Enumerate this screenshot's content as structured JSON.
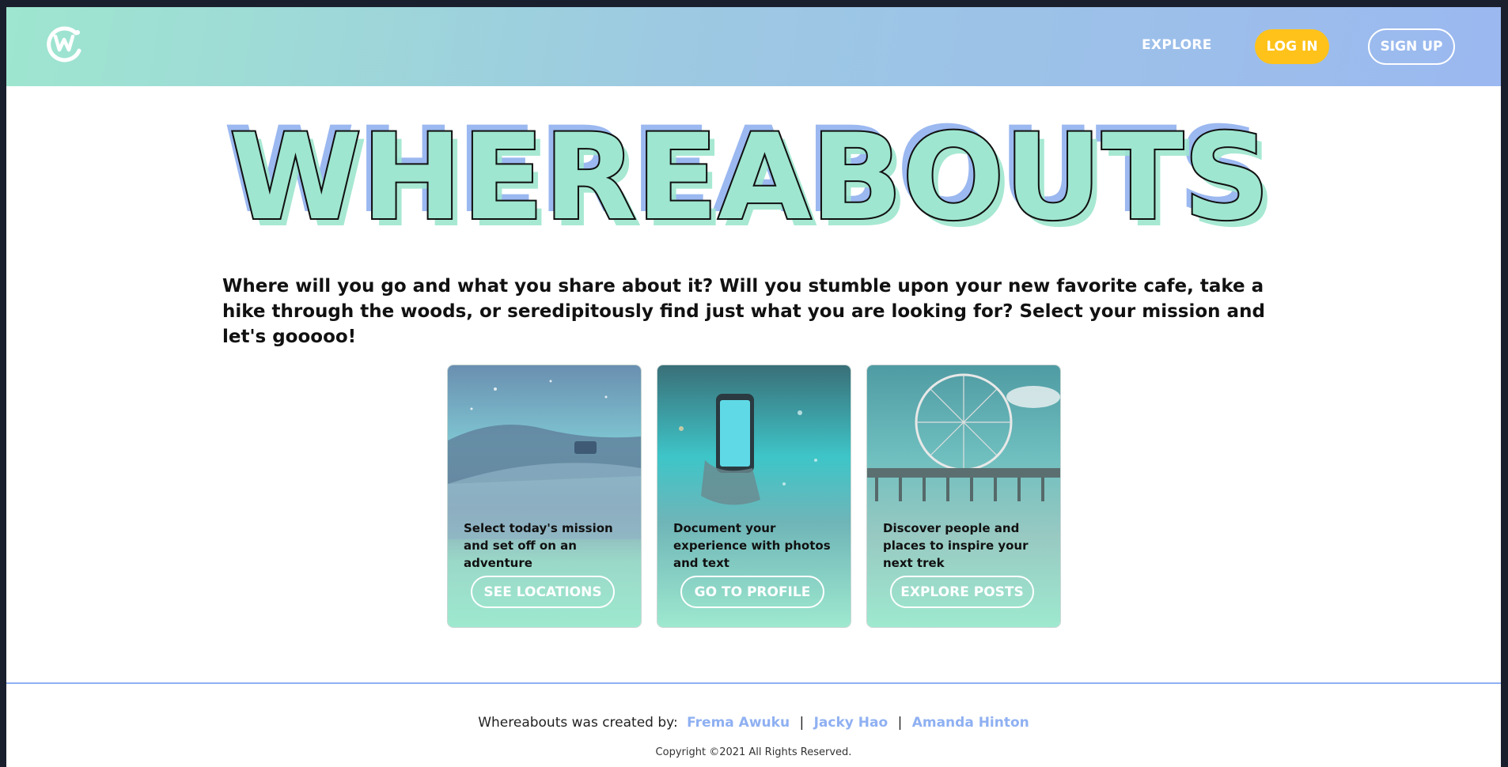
{
  "nav": {
    "logo_icon": "whereabouts-w-logo-icon",
    "explore_label": "EXPLORE",
    "login_label": "LOG IN",
    "signup_label": "SIGN UP"
  },
  "hero": {
    "title": "WHEREABOUTS",
    "intro": "Where will you go and what you share about it? Will you stumble upon your new favorite cafe, take a hike through the woods, or seredipitously find just what you are looking for? Select your mission and let's gooooo!"
  },
  "cards": [
    {
      "text": "Select today's mission and set off on an adventure",
      "button": "SEE LOCATIONS",
      "image": "night-sky-car-road-photo"
    },
    {
      "text": "Document your experience with photos and text",
      "button": "GO TO PROFILE",
      "image": "phone-fireworks-photo"
    },
    {
      "text": "Discover people and places to inspire your next trek",
      "button": "EXPLORE POSTS",
      "image": "ferris-wheel-pier-photo"
    }
  ],
  "footer": {
    "credits_prefix": "Whereabouts was created by:",
    "authors": [
      "Frema Awuku",
      "Jacky Hao",
      "Amanda Hinton"
    ],
    "separator": "|",
    "copyright": "Copyright ©2021 All Rights Reserved."
  },
  "colors": {
    "mint": "#9ee6cf",
    "periwinkle": "#9bb8f0",
    "accent_yellow": "#ffc21a",
    "link_blue": "#8fb0f2"
  }
}
